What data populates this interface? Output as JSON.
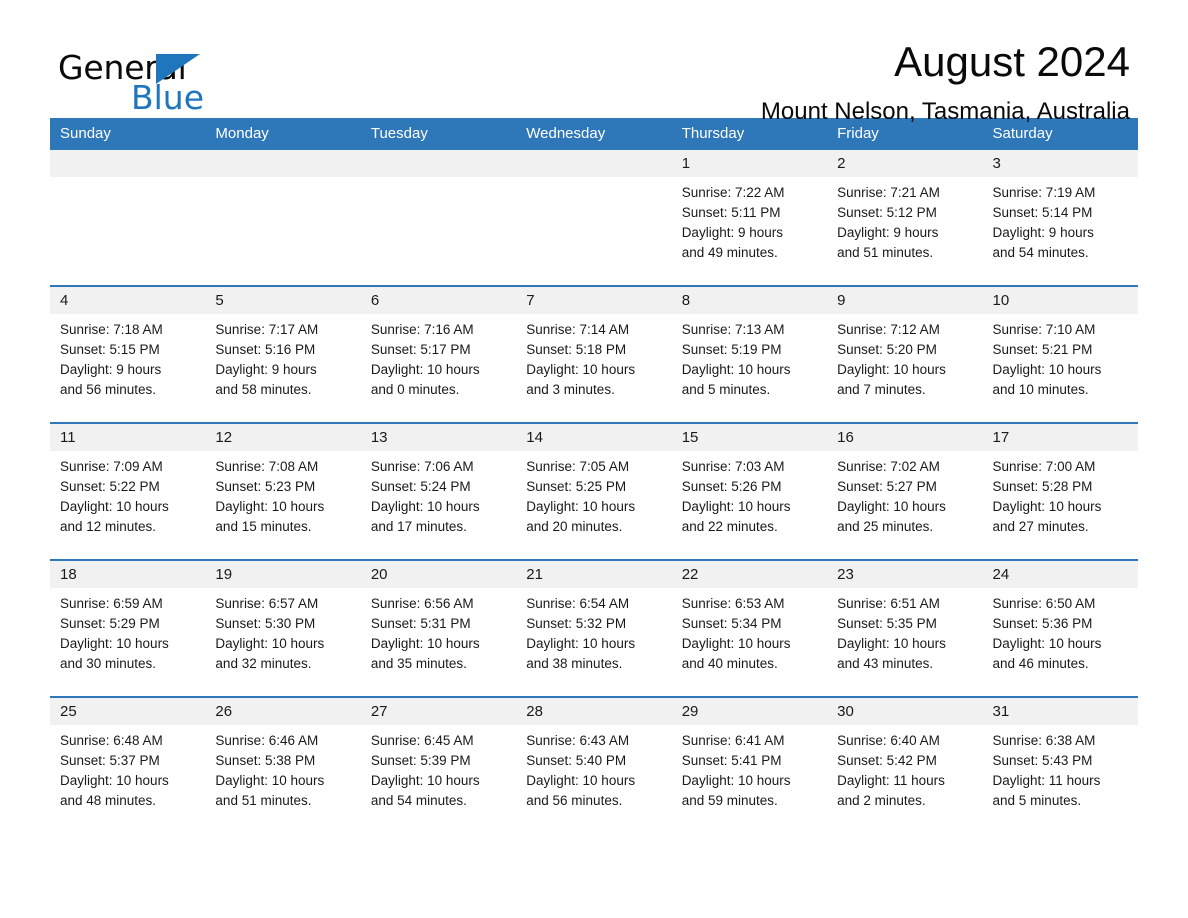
{
  "logo": {
    "word_one": "General",
    "word_two": "Blue",
    "triangle_icon": "triangle-icon",
    "brand_color": "#1f76bc"
  },
  "header": {
    "title": "August 2024",
    "subtitle": "Mount Nelson, Tasmania, Australia"
  },
  "theme": {
    "header_blue": "#2e77b8",
    "daynum_band": "#f1f1f1",
    "text": "#1a1a1a"
  },
  "weekday_headers": [
    "Sunday",
    "Monday",
    "Tuesday",
    "Wednesday",
    "Thursday",
    "Friday",
    "Saturday"
  ],
  "weeks": [
    [
      {
        "day": "",
        "sunrise": "",
        "sunset": "",
        "daylight_1": "",
        "daylight_2": ""
      },
      {
        "day": "",
        "sunrise": "",
        "sunset": "",
        "daylight_1": "",
        "daylight_2": ""
      },
      {
        "day": "",
        "sunrise": "",
        "sunset": "",
        "daylight_1": "",
        "daylight_2": ""
      },
      {
        "day": "",
        "sunrise": "",
        "sunset": "",
        "daylight_1": "",
        "daylight_2": ""
      },
      {
        "day": "1",
        "sunrise": "Sunrise: 7:22 AM",
        "sunset": "Sunset: 5:11 PM",
        "daylight_1": "Daylight: 9 hours",
        "daylight_2": "and 49 minutes."
      },
      {
        "day": "2",
        "sunrise": "Sunrise: 7:21 AM",
        "sunset": "Sunset: 5:12 PM",
        "daylight_1": "Daylight: 9 hours",
        "daylight_2": "and 51 minutes."
      },
      {
        "day": "3",
        "sunrise": "Sunrise: 7:19 AM",
        "sunset": "Sunset: 5:14 PM",
        "daylight_1": "Daylight: 9 hours",
        "daylight_2": "and 54 minutes."
      }
    ],
    [
      {
        "day": "4",
        "sunrise": "Sunrise: 7:18 AM",
        "sunset": "Sunset: 5:15 PM",
        "daylight_1": "Daylight: 9 hours",
        "daylight_2": "and 56 minutes."
      },
      {
        "day": "5",
        "sunrise": "Sunrise: 7:17 AM",
        "sunset": "Sunset: 5:16 PM",
        "daylight_1": "Daylight: 9 hours",
        "daylight_2": "and 58 minutes."
      },
      {
        "day": "6",
        "sunrise": "Sunrise: 7:16 AM",
        "sunset": "Sunset: 5:17 PM",
        "daylight_1": "Daylight: 10 hours",
        "daylight_2": "and 0 minutes."
      },
      {
        "day": "7",
        "sunrise": "Sunrise: 7:14 AM",
        "sunset": "Sunset: 5:18 PM",
        "daylight_1": "Daylight: 10 hours",
        "daylight_2": "and 3 minutes."
      },
      {
        "day": "8",
        "sunrise": "Sunrise: 7:13 AM",
        "sunset": "Sunset: 5:19 PM",
        "daylight_1": "Daylight: 10 hours",
        "daylight_2": "and 5 minutes."
      },
      {
        "day": "9",
        "sunrise": "Sunrise: 7:12 AM",
        "sunset": "Sunset: 5:20 PM",
        "daylight_1": "Daylight: 10 hours",
        "daylight_2": "and 7 minutes."
      },
      {
        "day": "10",
        "sunrise": "Sunrise: 7:10 AM",
        "sunset": "Sunset: 5:21 PM",
        "daylight_1": "Daylight: 10 hours",
        "daylight_2": "and 10 minutes."
      }
    ],
    [
      {
        "day": "11",
        "sunrise": "Sunrise: 7:09 AM",
        "sunset": "Sunset: 5:22 PM",
        "daylight_1": "Daylight: 10 hours",
        "daylight_2": "and 12 minutes."
      },
      {
        "day": "12",
        "sunrise": "Sunrise: 7:08 AM",
        "sunset": "Sunset: 5:23 PM",
        "daylight_1": "Daylight: 10 hours",
        "daylight_2": "and 15 minutes."
      },
      {
        "day": "13",
        "sunrise": "Sunrise: 7:06 AM",
        "sunset": "Sunset: 5:24 PM",
        "daylight_1": "Daylight: 10 hours",
        "daylight_2": "and 17 minutes."
      },
      {
        "day": "14",
        "sunrise": "Sunrise: 7:05 AM",
        "sunset": "Sunset: 5:25 PM",
        "daylight_1": "Daylight: 10 hours",
        "daylight_2": "and 20 minutes."
      },
      {
        "day": "15",
        "sunrise": "Sunrise: 7:03 AM",
        "sunset": "Sunset: 5:26 PM",
        "daylight_1": "Daylight: 10 hours",
        "daylight_2": "and 22 minutes."
      },
      {
        "day": "16",
        "sunrise": "Sunrise: 7:02 AM",
        "sunset": "Sunset: 5:27 PM",
        "daylight_1": "Daylight: 10 hours",
        "daylight_2": "and 25 minutes."
      },
      {
        "day": "17",
        "sunrise": "Sunrise: 7:00 AM",
        "sunset": "Sunset: 5:28 PM",
        "daylight_1": "Daylight: 10 hours",
        "daylight_2": "and 27 minutes."
      }
    ],
    [
      {
        "day": "18",
        "sunrise": "Sunrise: 6:59 AM",
        "sunset": "Sunset: 5:29 PM",
        "daylight_1": "Daylight: 10 hours",
        "daylight_2": "and 30 minutes."
      },
      {
        "day": "19",
        "sunrise": "Sunrise: 6:57 AM",
        "sunset": "Sunset: 5:30 PM",
        "daylight_1": "Daylight: 10 hours",
        "daylight_2": "and 32 minutes."
      },
      {
        "day": "20",
        "sunrise": "Sunrise: 6:56 AM",
        "sunset": "Sunset: 5:31 PM",
        "daylight_1": "Daylight: 10 hours",
        "daylight_2": "and 35 minutes."
      },
      {
        "day": "21",
        "sunrise": "Sunrise: 6:54 AM",
        "sunset": "Sunset: 5:32 PM",
        "daylight_1": "Daylight: 10 hours",
        "daylight_2": "and 38 minutes."
      },
      {
        "day": "22",
        "sunrise": "Sunrise: 6:53 AM",
        "sunset": "Sunset: 5:34 PM",
        "daylight_1": "Daylight: 10 hours",
        "daylight_2": "and 40 minutes."
      },
      {
        "day": "23",
        "sunrise": "Sunrise: 6:51 AM",
        "sunset": "Sunset: 5:35 PM",
        "daylight_1": "Daylight: 10 hours",
        "daylight_2": "and 43 minutes."
      },
      {
        "day": "24",
        "sunrise": "Sunrise: 6:50 AM",
        "sunset": "Sunset: 5:36 PM",
        "daylight_1": "Daylight: 10 hours",
        "daylight_2": "and 46 minutes."
      }
    ],
    [
      {
        "day": "25",
        "sunrise": "Sunrise: 6:48 AM",
        "sunset": "Sunset: 5:37 PM",
        "daylight_1": "Daylight: 10 hours",
        "daylight_2": "and 48 minutes."
      },
      {
        "day": "26",
        "sunrise": "Sunrise: 6:46 AM",
        "sunset": "Sunset: 5:38 PM",
        "daylight_1": "Daylight: 10 hours",
        "daylight_2": "and 51 minutes."
      },
      {
        "day": "27",
        "sunrise": "Sunrise: 6:45 AM",
        "sunset": "Sunset: 5:39 PM",
        "daylight_1": "Daylight: 10 hours",
        "daylight_2": "and 54 minutes."
      },
      {
        "day": "28",
        "sunrise": "Sunrise: 6:43 AM",
        "sunset": "Sunset: 5:40 PM",
        "daylight_1": "Daylight: 10 hours",
        "daylight_2": "and 56 minutes."
      },
      {
        "day": "29",
        "sunrise": "Sunrise: 6:41 AM",
        "sunset": "Sunset: 5:41 PM",
        "daylight_1": "Daylight: 10 hours",
        "daylight_2": "and 59 minutes."
      },
      {
        "day": "30",
        "sunrise": "Sunrise: 6:40 AM",
        "sunset": "Sunset: 5:42 PM",
        "daylight_1": "Daylight: 11 hours",
        "daylight_2": "and 2 minutes."
      },
      {
        "day": "31",
        "sunrise": "Sunrise: 6:38 AM",
        "sunset": "Sunset: 5:43 PM",
        "daylight_1": "Daylight: 11 hours",
        "daylight_2": "and 5 minutes."
      }
    ]
  ]
}
